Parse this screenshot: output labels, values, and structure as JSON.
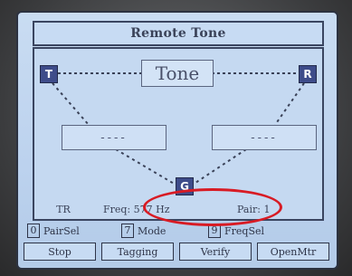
{
  "screen": {
    "title": "Remote Tone"
  },
  "diagram": {
    "tone_label": "Tone",
    "node_left": "T",
    "node_right": "R",
    "node_bottom": "G",
    "left_box_value": "----",
    "right_box_value": "----"
  },
  "status": {
    "tr_label": "TR",
    "freq_text": "Freq: 577 Hz",
    "pair_text": "Pair:   1"
  },
  "keys": [
    {
      "key": "0",
      "label": "PairSel"
    },
    {
      "key": "7",
      "label": "Mode"
    },
    {
      "key": "9",
      "label": "FreqSel"
    }
  ],
  "softkeys": [
    "Stop",
    "Tagging",
    "Verify",
    "OpenMtr"
  ],
  "colors": {
    "screen_bg": "#c5d9f1",
    "border": "#3a4560",
    "node_fill": "#3e4c8a",
    "highlight_ellipse": "#d81b24"
  }
}
